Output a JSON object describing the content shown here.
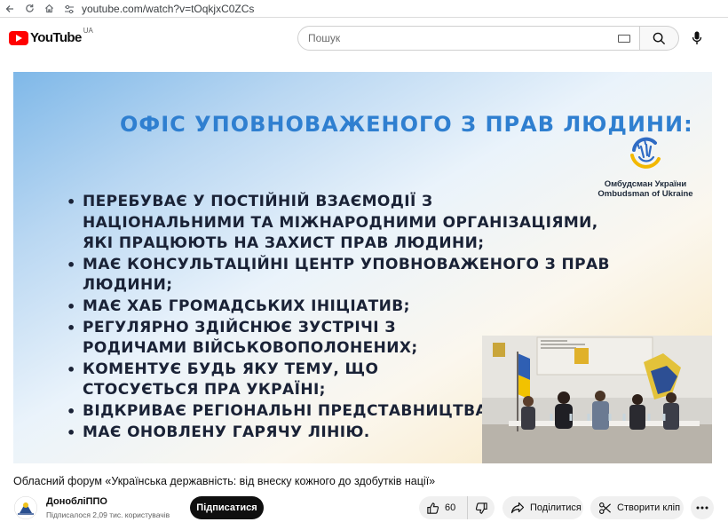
{
  "browser": {
    "url": "youtube.com/watch?v=tOqkjxC0ZCs"
  },
  "header": {
    "logo_text": "YouTube",
    "region": "UA",
    "search_placeholder": "Пошук"
  },
  "slide": {
    "title": "ОФІС УПОВНОВАЖЕНОГО З ПРАВ ЛЮДИНИ:",
    "logo_lines": [
      "Омбудсман України",
      "Ombudsman of Ukraine"
    ],
    "bullets": [
      "ПЕРЕБУВАЄ У ПОСТІЙНІЙ ВЗАЄМОДІЇ З НАЦІОНАЛЬНИМИ ТА МІЖНАРОДНИМИ ОРГАНІЗАЦІЯМИ, ЯКІ ПРАЦЮЮТЬ НА ЗАХИСТ ПРАВ ЛЮДИНИ;",
      "МАЄ КОНСУЛЬТАЦІЙНІ ЦЕНТР УПОВНОВАЖЕНОГО З ПРАВ ЛЮДИНИ;",
      "МАЄ ХАБ ГРОМАДСЬКИХ ІНІЦІАТИВ;",
      "РЕГУЛЯРНО ЗДІЙСНЮЄ ЗУСТРІЧІ З РОДИЧАМИ ВІЙСЬКОВОПОЛОНЕНИХ;",
      "КОМЕНТУЄ БУДЬ ЯКУ ТЕМУ, ЩО СТОСУЄТЬСЯ ПРА УКРАЇНІ;",
      "ВІДКРИВАЄ РЕГІОНАЛЬНІ ПРЕДСТАВНИЦТВА В КО",
      "МАЄ ОНОВЛЕНУ ГАРЯЧУ ЛІНІЮ."
    ]
  },
  "video": {
    "title": "Обласний форум «Українська державність: від внеску кожного до здобутків нації»"
  },
  "channel": {
    "name": "ДонобліППО",
    "subscribers": "Підписалося 2,09 тис. користувачів",
    "subscribe_label": "Підписатися"
  },
  "actions": {
    "likes": "60",
    "share_label": "Поділитися",
    "clip_label": "Створити кліп"
  },
  "colors": {
    "brand_red": "#ff0000",
    "slide_title": "#2f7fd0",
    "slide_text": "#1a2236"
  }
}
